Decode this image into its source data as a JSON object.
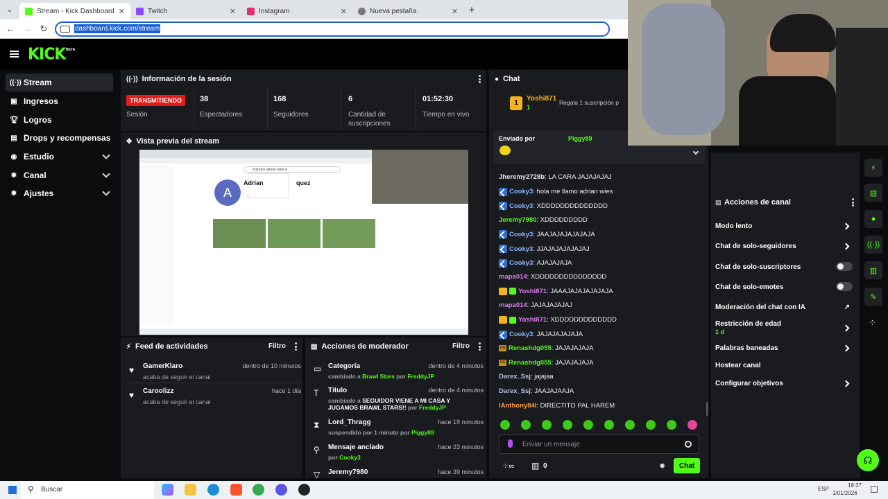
{
  "browser": {
    "tabs": [
      {
        "title": "Stream - Kick Dashboard",
        "color": "#53fc18"
      },
      {
        "title": "Twitch",
        "color": "#9146ff"
      },
      {
        "title": "Instagram",
        "color": "#e1306c"
      },
      {
        "title": "Nueva pestaña",
        "color": "#777777"
      }
    ],
    "url": "dashboard.kick.com/stream"
  },
  "brand": {
    "logo": "KICK",
    "badge": "BETA",
    "accent": "#53fc18"
  },
  "sidebar": {
    "items": [
      {
        "label": "Stream",
        "icon": "broadcast-icon"
      },
      {
        "label": "Ingresos",
        "icon": "wallet-icon"
      },
      {
        "label": "Logros",
        "icon": "trophy-icon"
      },
      {
        "label": "Drops y recompensas",
        "icon": "gift-icon"
      },
      {
        "label": "Estudio",
        "icon": "palette-icon"
      },
      {
        "label": "Canal",
        "icon": "gear-icon"
      },
      {
        "label": "Ajustes",
        "icon": "gear-icon"
      }
    ]
  },
  "session": {
    "title": "Información de la sesión",
    "live_badge": "TRANSMITIENDO",
    "live_label": "Sesión",
    "stats": [
      {
        "value": "38",
        "label": "Espectadores"
      },
      {
        "value": "168",
        "label": "Seguidores"
      },
      {
        "value": "6",
        "label": "Cantidad de suscripciones"
      },
      {
        "value": "01:52:30",
        "label": "Tiempo en vivo"
      }
    ]
  },
  "preview": {
    "title": "Vista previa del stream",
    "channel_letter": "A",
    "channel_name": "Adrian",
    "channel_name_end": "quez",
    "search_text": "brandon adrian wies w"
  },
  "activity": {
    "title": "Feed de actividades",
    "filter": "Filtro",
    "items": [
      {
        "name": "GamerKlaro",
        "action": "acaba de seguir el canal",
        "time": "dentro de 10 minutos"
      },
      {
        "name": "Caroolizz",
        "action": "acaba de seguir el canal",
        "time": "hace 1 día"
      }
    ]
  },
  "moderator": {
    "title": "Acciones de moderador",
    "filter": "Filtro",
    "items": [
      {
        "name": "Categoría",
        "pre": "cambiado a ",
        "hl": "Brawl Stars",
        "mid": " por ",
        "by": "FreddyJP",
        "time": "dentro de 4 minutos",
        "icon": "category-icon"
      },
      {
        "name": "Título",
        "pre": "cambiado a ",
        "hl": "SEGUIDOR VIENE A MI CASA Y JUGAMOS BRAWL STARS!!",
        "mid": " por ",
        "by": "FreddyJP",
        "time": "dentro de 4 minutos",
        "icon": "title-icon"
      },
      {
        "name": "Lord_Thragg",
        "pre": "suspendido por 1 minuto por ",
        "hl": "",
        "mid": "",
        "by": "Piggy89",
        "time": "hace 19 minutos",
        "icon": "hourglass-icon"
      },
      {
        "name": "Mensaje anclado",
        "pre": "por ",
        "hl": "",
        "mid": "",
        "by": "Cooky3",
        "time": "hace 23 minutos",
        "icon": "pin-icon"
      },
      {
        "name": "Jeremy7980",
        "pre": "",
        "hl": "",
        "mid": "",
        "by": "",
        "time": "hace 39 minutos",
        "icon": "chevron-icon"
      }
    ]
  },
  "chat": {
    "title": "Chat",
    "top_gifter": {
      "rank": "1",
      "name": "Yoshi871",
      "count": "1",
      "gift_text": "Regala 1 suscripción p"
    },
    "pinned": {
      "label": "Enviado por",
      "by": "Piggy89"
    },
    "messages": [
      {
        "user": "Jheremy2728b",
        "text": "LA CARA JAJAJAJAJ",
        "color": "#e8e8e8",
        "badges": []
      },
      {
        "user": "Cooky3",
        "text": "hola me llamo adrian wies",
        "color": "#8bb4ff",
        "badges": [
          "kb"
        ]
      },
      {
        "user": "Cooky3",
        "text": "XDDDDDDDDDDDDDD",
        "color": "#8bb4ff",
        "badges": [
          "kb"
        ]
      },
      {
        "user": "Jeremy7980",
        "text": "XDDDDDDDDD",
        "color": "#53fc18",
        "badges": []
      },
      {
        "user": "Cooky3",
        "text": "JAAJAJAJAJAJAJA",
        "color": "#8bb4ff",
        "badges": [
          "kb"
        ]
      },
      {
        "user": "Cooky3",
        "text": "JJAJAJAJAJAJAJ",
        "color": "#8bb4ff",
        "badges": [
          "kb"
        ]
      },
      {
        "user": "Cooky3",
        "text": "AJAJAJAJA",
        "color": "#8bb4ff",
        "badges": [
          "kb"
        ]
      },
      {
        "user": "mapa014",
        "text": "XDDDDDDDDDDDDDDD",
        "color": "#e07bf0",
        "badges": []
      },
      {
        "user": "Yoshi871",
        "text": "JAAAJAJAJAJAJAJA",
        "color": "#e07bf0",
        "badges": [
          "crown",
          "sub"
        ]
      },
      {
        "user": "mapa014",
        "text": "JAJAJAJAJAJ",
        "color": "#e07bf0",
        "badges": []
      },
      {
        "user": "Yoshi871",
        "text": "XDDDDDDDDDDDDD",
        "color": "#e07bf0",
        "badges": [
          "crown",
          "sub"
        ]
      },
      {
        "user": "Cooky3",
        "text": "JAJAJAJAJAJA",
        "color": "#8bb4ff",
        "badges": [
          "kb"
        ]
      },
      {
        "user": "Renashdg055",
        "text": "JAJAJAJAJA",
        "color": "#53fc18",
        "badges": [
          "og"
        ]
      },
      {
        "user": "Renashdg055",
        "text": "JAJAJAJAJA",
        "color": "#53fc18",
        "badges": [
          "og"
        ]
      },
      {
        "user": "Darex_Ssj",
        "text": "jajajaa",
        "color": "#b7c4e8",
        "badges": []
      },
      {
        "user": "Darex_Ssj",
        "text": "JAAJAJAAJA",
        "color": "#b7c4e8",
        "badges": []
      },
      {
        "user": "lAnthony84l",
        "text": "DIRECTITO PAL HAREM",
        "color": "#ff9b3a",
        "badges": []
      }
    ],
    "input_placeholder": "Enviar un mensaje",
    "points": "0",
    "send_label": "Chat"
  },
  "channel_actions": {
    "title": "Acciones de canal",
    "items": [
      {
        "label": "Modo lento",
        "control": "arrow"
      },
      {
        "label": "Chat de solo-seguidores",
        "control": "arrow"
      },
      {
        "label": "Chat de solo-suscriptores",
        "control": "toggle"
      },
      {
        "label": "Chat de solo-emotes",
        "control": "toggle"
      },
      {
        "label": "Moderación del chat con IA",
        "control": "external"
      },
      {
        "label": "Restricción de edad",
        "sub": "1 d",
        "control": "arrow"
      },
      {
        "label": "Palabras baneadas",
        "control": "arrow"
      },
      {
        "label": "Hostear canal",
        "control": "none"
      },
      {
        "label": "Configurar objetivos",
        "control": "arrow"
      }
    ]
  },
  "taskbar": {
    "search": "Buscar",
    "lang": "ESP",
    "time": "19:37",
    "date": "1/01/2026"
  }
}
